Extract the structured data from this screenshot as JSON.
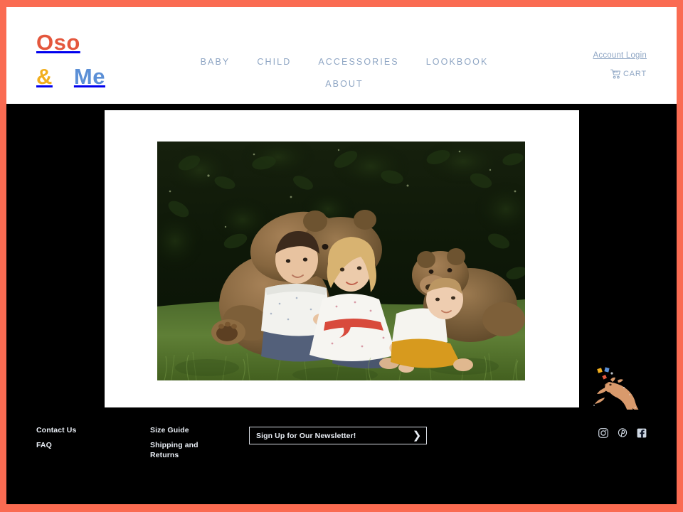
{
  "theme": {
    "frame_color": "#FA6B52",
    "header_bg": "#ffffff",
    "body_bg": "#000000",
    "nav_color": "#8FA6C4",
    "logo_oso_color": "#E4573D",
    "logo_amp_color": "#F2AF1E",
    "logo_me_color": "#5B8FD6",
    "footer_text_color": "#e9eef5"
  },
  "header": {
    "logo": {
      "line1": "Oso",
      "amp": "&",
      "line2": "Me"
    },
    "nav": {
      "row1": [
        {
          "label": "BABY",
          "name": "nav-link-baby"
        },
        {
          "label": "CHILD",
          "name": "nav-link-child"
        },
        {
          "label": "ACCESSORIES",
          "name": "nav-link-accessories"
        },
        {
          "label": "LOOKBOOK",
          "name": "nav-link-lookbook"
        }
      ],
      "row2": [
        {
          "label": "ABOUT",
          "name": "nav-link-about"
        }
      ]
    },
    "account": {
      "login_label": "Account Login",
      "cart_label": "CART",
      "cart_icon": "shopping-cart-icon"
    }
  },
  "main": {
    "hero": {
      "alt": "Three young children sitting on grass with large brown teddy bears in front of a dark green hedge",
      "panel_bg": "#ffffff"
    }
  },
  "decor": {
    "dog_graphic": "jumping-dog-icon",
    "confetti_colors": [
      "#F2AF1E",
      "#5B8FD6",
      "#E4573D"
    ]
  },
  "footer": {
    "columns": [
      {
        "name": "footer-column-1",
        "links": [
          {
            "label": "Contact Us",
            "name": "footer-link-contact-us"
          },
          {
            "label": "FAQ",
            "name": "footer-link-faq"
          }
        ]
      },
      {
        "name": "footer-column-2",
        "links": [
          {
            "label": "Size Guide",
            "name": "footer-link-size-guide"
          },
          {
            "label": "Shipping and Returns",
            "name": "footer-link-shipping-and-returns"
          }
        ]
      }
    ],
    "newsletter": {
      "placeholder": "Sign Up for Our Newsletter!",
      "value": "",
      "submit_icon": "chevron-right-icon"
    },
    "social": [
      {
        "name": "instagram-icon",
        "label": "Instagram"
      },
      {
        "name": "pinterest-icon",
        "label": "Pinterest"
      },
      {
        "name": "facebook-icon",
        "label": "Facebook"
      }
    ]
  }
}
